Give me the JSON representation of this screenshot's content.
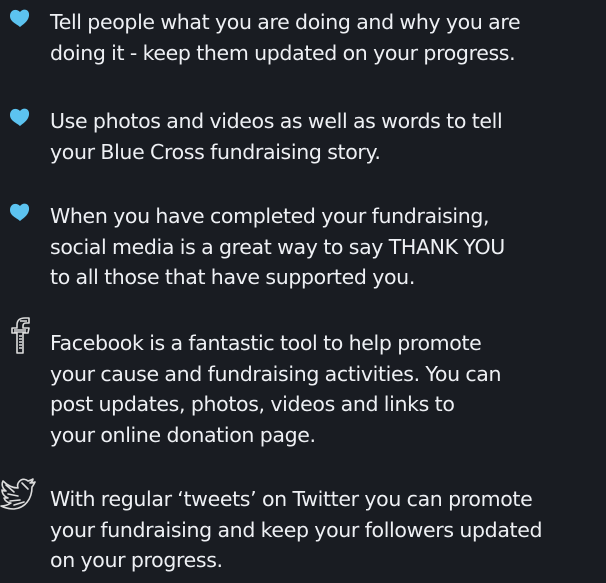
{
  "colors": {
    "background": "#191c22",
    "text": "#eef0f4",
    "heart": "#5cc3f0",
    "facebook": "#dcdcdc",
    "twitter": "#dcdcdc"
  },
  "items": [
    {
      "icon": "heart-icon",
      "text": "Tell people what you are doing and why you are\ndoing it - keep them updated on your progress."
    },
    {
      "icon": "heart-icon",
      "text": "Use photos and videos as well as words to tell\nyour Blue Cross fundraising story."
    },
    {
      "icon": "heart-icon",
      "text": "When you have completed your fundraising,\nsocial media is a great way to say THANK YOU\nto all those that have supported you."
    },
    {
      "icon": "facebook-icon",
      "text": "Facebook is a fantastic tool to help promote\nyour  cause and fundraising activities. You can\npost updates, photos, videos and links to\nyour online donation page."
    },
    {
      "icon": "twitter-bird-icon",
      "text": "With regular ‘tweets’ on Twitter you can promote\nyour  fundraising and keep your followers updated\non your progress."
    }
  ]
}
